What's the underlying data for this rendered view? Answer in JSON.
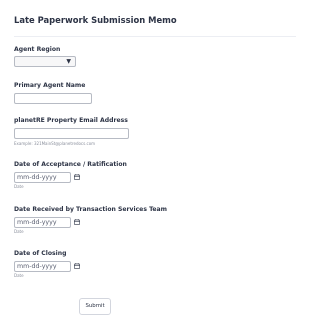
{
  "form": {
    "title": "Late Paperwork Submission Memo",
    "agent_region": {
      "label": "Agent Region",
      "selected_value": "",
      "arrow_icon": "chevron-down-icon"
    },
    "primary_agent_name": {
      "label": "Primary Agent Name",
      "value": ""
    },
    "email": {
      "label": "planetRE Property Email Address",
      "value": "",
      "example": "Example: 321MainSt@planetredocs.com"
    },
    "date_acceptance": {
      "label": "Date of Acceptance / Ratification",
      "placeholder": "mm-dd-yyyy",
      "sublabel": "Date",
      "icon": "calendar-icon"
    },
    "date_received": {
      "label": "Date Received by Transaction Services Team",
      "placeholder": "mm-dd-yyyy",
      "sublabel": "Date",
      "icon": "calendar-icon"
    },
    "date_closing": {
      "label": "Date of Closing",
      "placeholder": "mm-dd-yyyy",
      "sublabel": "Date",
      "icon": "calendar-icon"
    },
    "submit_label": "Submit"
  },
  "colors": {
    "text": "#2c3345",
    "border": "#b7bbc4",
    "sublabel": "#8a8f9c"
  }
}
